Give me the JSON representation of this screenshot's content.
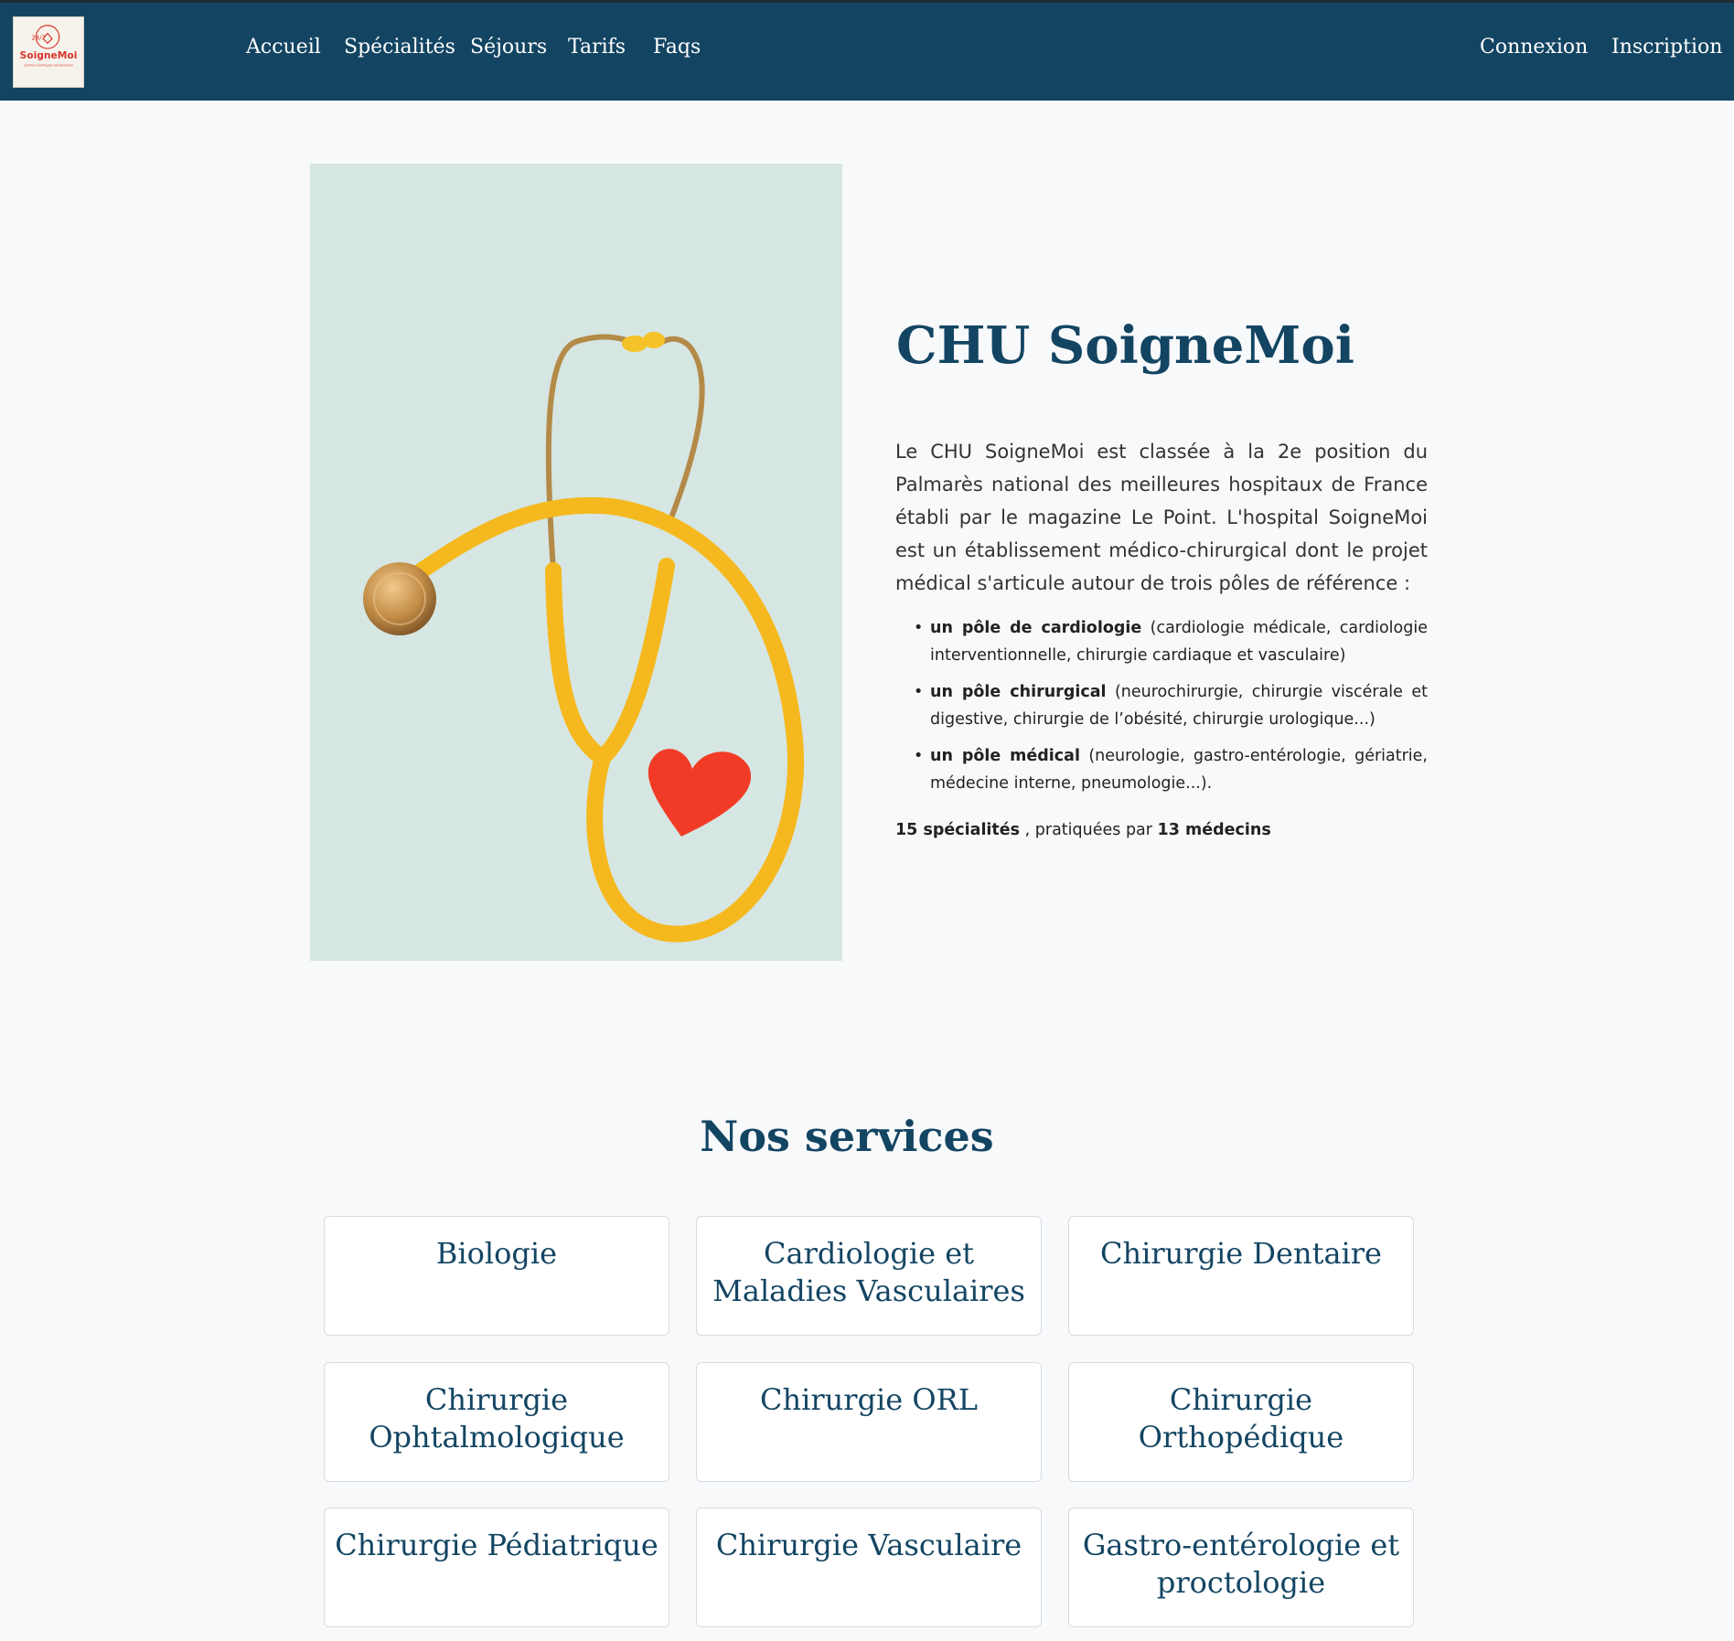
{
  "brand": {
    "name": "SoigneMoi",
    "badge": "24/7",
    "tagline": "CENTRE HOSPITALIER UNIVERSITAIRE"
  },
  "nav": {
    "links": [
      "Accueil",
      "Spécialités",
      "Séjours",
      "Tarifs",
      "Faqs"
    ],
    "login": "Connexion",
    "signup": "Inscription"
  },
  "hero": {
    "title": "CHU SoigneMoi",
    "intro": "Le CHU SoigneMoi est classée à la 2e position du Palmarès national des meilleures hospitaux de France établi par le magazine Le Point. L'hospital SoigneMoi est un établissement médico-chirurgical dont le projet médical s'articule autour de trois pôles de référence :",
    "poles": [
      {
        "strong": "un pôle de cardiologie",
        "text": " (cardiologie médicale, cardiologie interventionnelle, chirurgie cardiaque et vasculaire)"
      },
      {
        "strong": "un pôle chirurgical",
        "text": " (neurochirurgie, chirurgie viscérale et digestive, chirurgie de l’obésité, chirurgie urologique...)"
      },
      {
        "strong": "un pôle médical",
        "text": " (neurologie, gastro-entérologie, gériatrie, médecine interne, pneumologie...)."
      }
    ],
    "stats": {
      "specialties": "15 spécialités",
      "middle": " , pratiquées par ",
      "doctors": "13 médecins"
    }
  },
  "services": {
    "title": "Nos services",
    "items": [
      "Biologie",
      "Cardiologie et Maladies Vasculaires",
      "Chirurgie Dentaire",
      "Chirurgie Ophtalmologique",
      "Chirurgie ORL",
      "Chirurgie Orthopédique",
      "Chirurgie Pédiatrique",
      "Chirurgie Vasculaire",
      "Gastro-entérologie et proctologie"
    ]
  },
  "colors": {
    "navbar": "#134563",
    "accent": "#134563",
    "background": "#f8f9fa",
    "card_border": "#d7dbe0",
    "logo_red": "#d9352b"
  },
  "icons": {
    "hero_image": "stethoscope-with-red-heart"
  }
}
